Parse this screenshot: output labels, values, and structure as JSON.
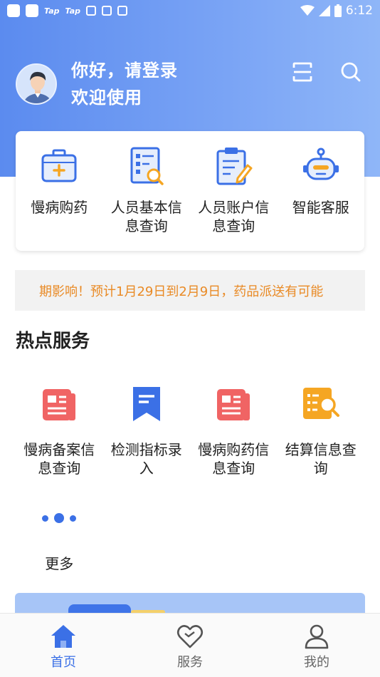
{
  "status_bar": {
    "tap1": "Tap",
    "tap2": "Tap",
    "time": "6:12"
  },
  "header": {
    "greeting": "你好，请登录",
    "welcome": "欢迎使用"
  },
  "quick_actions": [
    {
      "label": "慢病购药",
      "icon": "medicine-box-icon"
    },
    {
      "label": "人员基本信息查询",
      "icon": "document-search-icon"
    },
    {
      "label": "人员账户信息查询",
      "icon": "clipboard-edit-icon"
    },
    {
      "label": "智能客服",
      "icon": "robot-icon"
    }
  ],
  "notice": {
    "text": "期影响！预计1月29日到2月9日，药品派送有可能"
  },
  "hot_services": {
    "title": "热点服务",
    "items": [
      {
        "label": "慢病备案信息查询",
        "icon": "news-icon"
      },
      {
        "label": "检测指标录入",
        "icon": "bookmark-icon"
      },
      {
        "label": "慢病购药信息查询",
        "icon": "news-icon"
      },
      {
        "label": "结算信息查询",
        "icon": "list-search-icon"
      }
    ],
    "more_label": "更多"
  },
  "tabbar": {
    "tabs": [
      {
        "label": "首页",
        "active": true
      },
      {
        "label": "服务",
        "active": false
      },
      {
        "label": "我的",
        "active": false
      }
    ]
  },
  "colors": {
    "accent": "#3b70e6",
    "notice": "#e98a25",
    "card_red": "#f06464",
    "card_orange": "#f5a623"
  }
}
